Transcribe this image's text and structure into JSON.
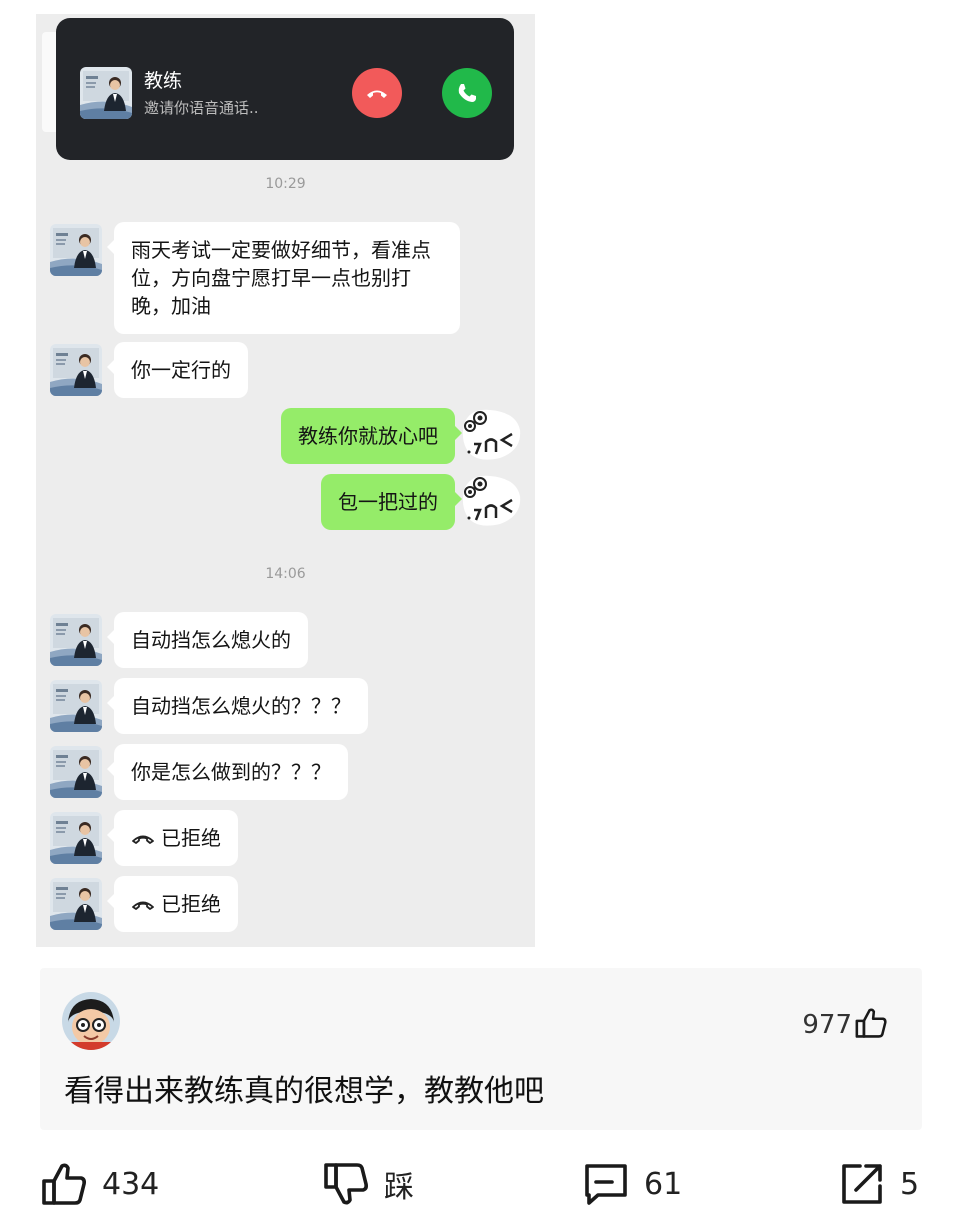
{
  "call": {
    "caller_name": "教练",
    "subtitle": "邀请你语音通话.."
  },
  "timestamps": [
    "10:29",
    "14:06"
  ],
  "messages": {
    "m1": "雨天考试一定要做好细节，看准点位，方向盘宁愿打早一点也别打晚，加油",
    "m2": "你一定行的",
    "m3": "教练你就放心吧",
    "m4": "包一把过的",
    "m5": "自动挡怎么熄火的",
    "m6": "自动挡怎么熄火的？？？",
    "m7": "你是怎么做到的？？？",
    "m8": "已拒绝",
    "m9": "已拒绝"
  },
  "comment": {
    "text": "看得出来教练真的很想学，教教他吧",
    "likes": "977"
  },
  "actions": {
    "like_count": "434",
    "dislike_label": "踩",
    "comment_count": "61",
    "share_count": "5"
  },
  "icons": {
    "decline": "phone-decline-icon",
    "accept": "phone-accept-icon",
    "thumb_up": "thumb-up-icon",
    "thumb_down": "thumb-down-icon",
    "comment": "comment-icon",
    "share": "share-icon"
  },
  "colors": {
    "chat_background": "#ededed",
    "outgoing_bubble": "#95ec69",
    "incoming_bubble": "#ffffff",
    "call_banner": "#222428",
    "decline_button": "#f25a5a",
    "accept_button": "#21b94a"
  }
}
